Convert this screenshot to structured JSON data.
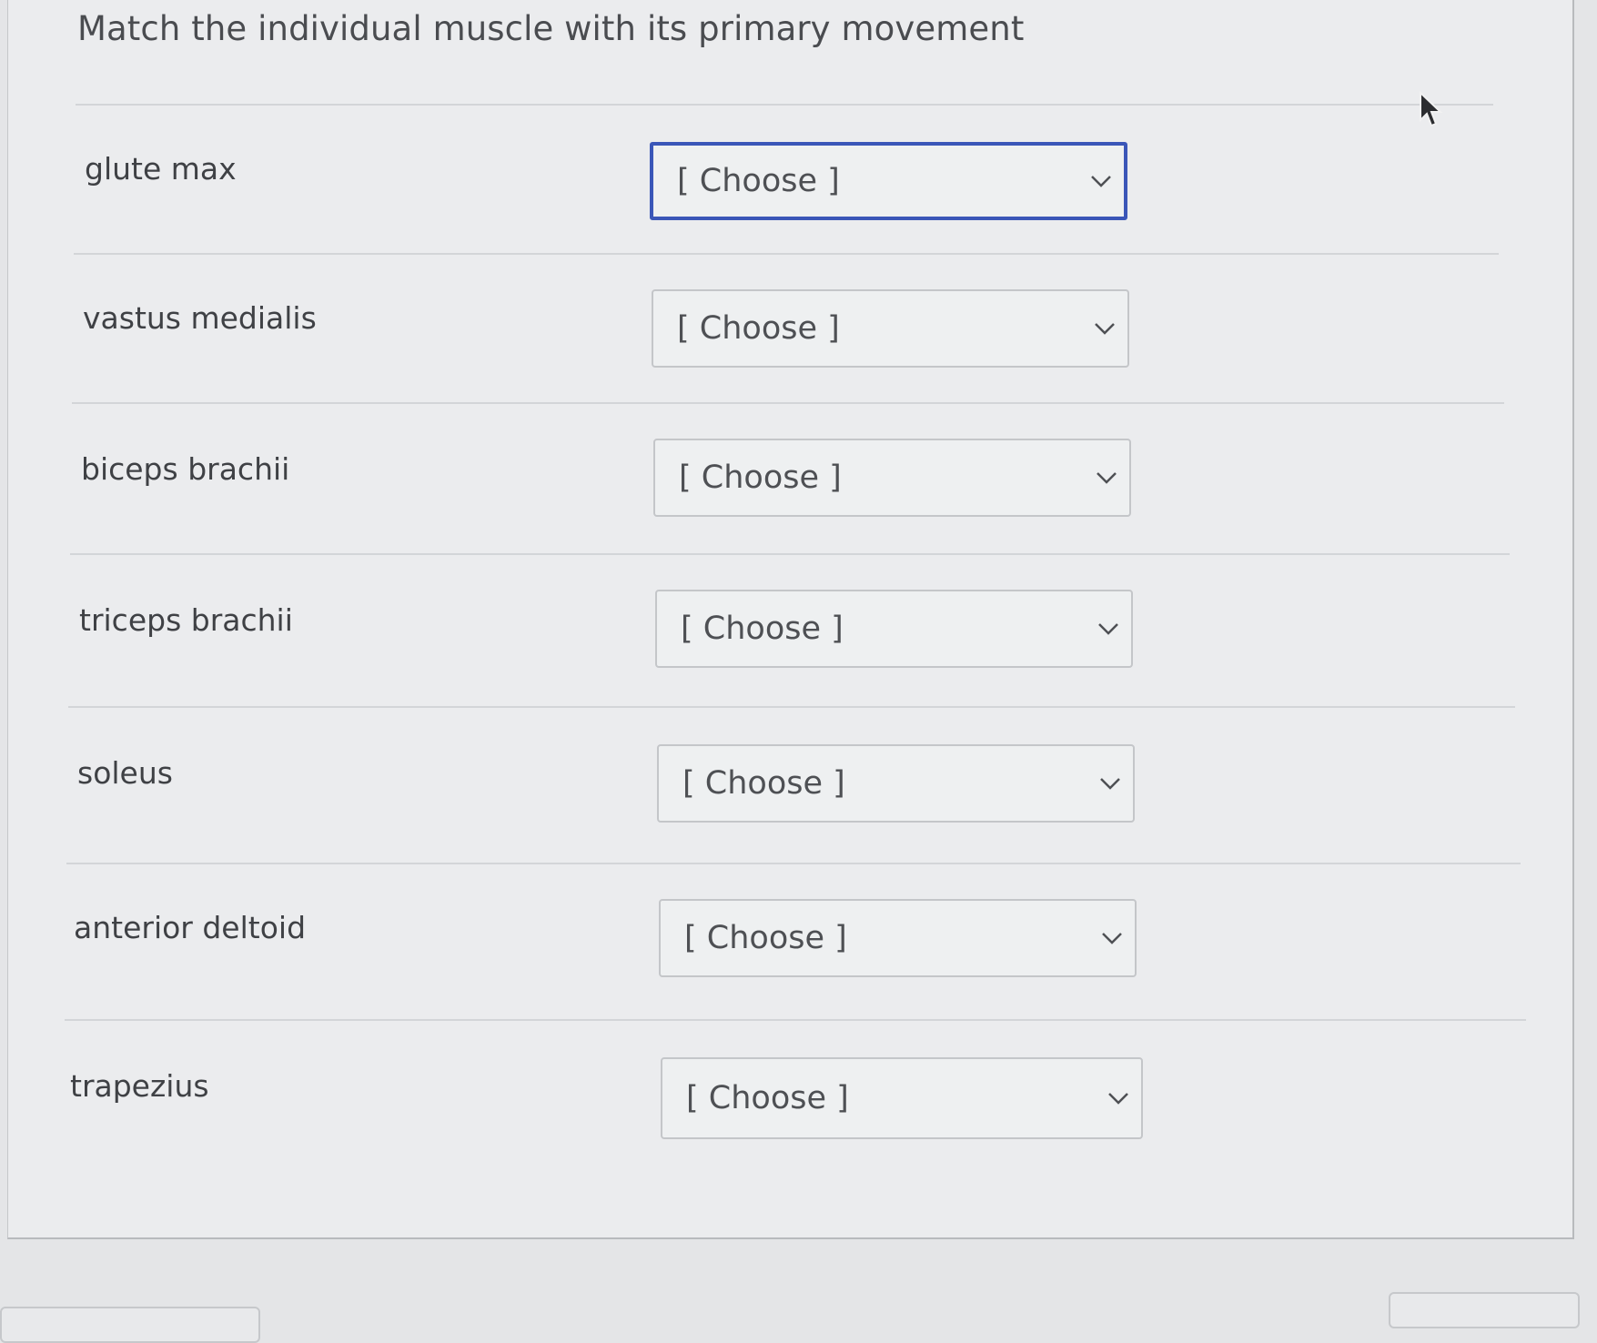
{
  "question": {
    "title": "Match the individual muscle with its primary movement"
  },
  "rows": [
    {
      "muscle": "glute max",
      "selected": "[ Choose ]"
    },
    {
      "muscle": "vastus medialis",
      "selected": "[ Choose ]"
    },
    {
      "muscle": "biceps brachii",
      "selected": "[ Choose ]"
    },
    {
      "muscle": "triceps brachii",
      "selected": "[ Choose ]"
    },
    {
      "muscle": "soleus",
      "selected": "[ Choose ]"
    },
    {
      "muscle": "anterior deltoid",
      "selected": "[ Choose ]"
    },
    {
      "muscle": "trapezius",
      "selected": "[ Choose ]"
    }
  ],
  "icons": {
    "dropdown": "chevron-down-icon",
    "pointer": "mouse-cursor-icon"
  },
  "colors": {
    "focus_border": "#3a56b8",
    "text": "#3f4145"
  }
}
